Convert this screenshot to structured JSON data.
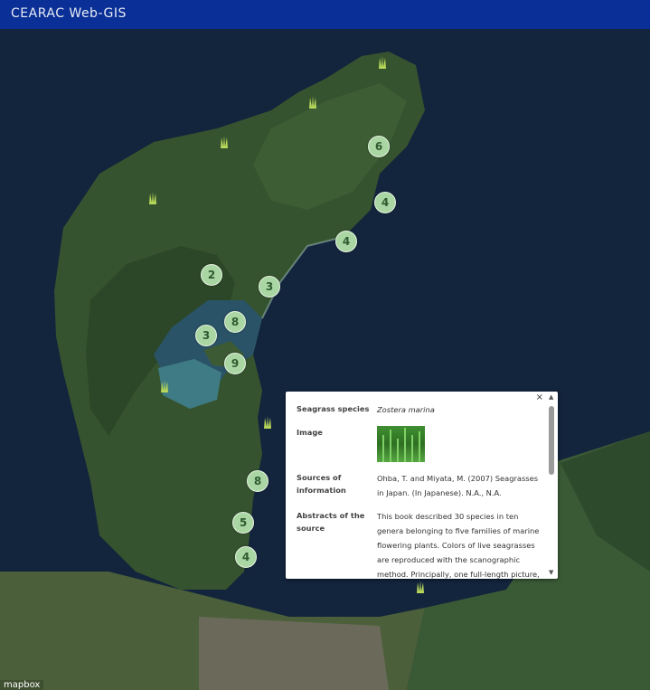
{
  "app": {
    "title": "CEARAC Web-GIS"
  },
  "map": {
    "attribution": "mapbox",
    "clusters": [
      {
        "label": "6"
      },
      {
        "label": "4"
      },
      {
        "label": "4"
      },
      {
        "label": "2"
      },
      {
        "label": "3"
      },
      {
        "label": "8"
      },
      {
        "label": "3"
      },
      {
        "label": "9"
      },
      {
        "label": "8"
      },
      {
        "label": "5"
      },
      {
        "label": "4"
      }
    ],
    "single_marker_icon": "seagrass-icon",
    "colors": {
      "cluster": "#a9d6a3",
      "header": "#0a2f96"
    }
  },
  "popup": {
    "close_symbol": "×",
    "species_label": "Seagrass species",
    "species_value": "Zostera marina",
    "image_label": "Image",
    "sources_label": "Sources of information",
    "sources_value": "Ohba, T. and Miyata, M. (2007) Seagrasses in Japan. (In Japanese). N.A., N.A.",
    "abstract_label": "Abstracts of the source",
    "abstract_value": "This book described 30 species in ten genera belonging to five families of marine flowering plants. Colors of live seagrasses are reproduced with the scanographic method. Principally, one full-length picture, partially magnified pictures and dissected"
  }
}
